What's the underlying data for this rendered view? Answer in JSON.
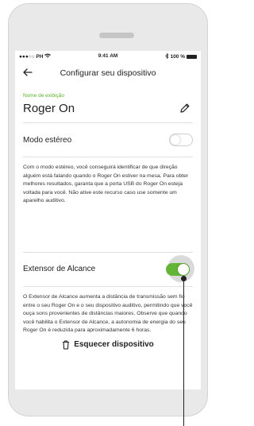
{
  "status_bar": {
    "carrier": "●●●○○ PH",
    "time": "9:41 AM",
    "battery_text": "100 %"
  },
  "nav": {
    "title": "Configurar seu dispositivo"
  },
  "device_name": {
    "label": "Nome de exibição",
    "value": "Roger On"
  },
  "stereo": {
    "label": "Modo estéreo",
    "enabled": false,
    "description": "Com o modo estéreo, você conseguirá identificar de que direção alguém está falando quando o Roger On estiver na mesa. Para obter melhores resultados, garanta que a porta USB do Roger On esteja voltada para você. Não ative este recurso caso use somente um aparelho auditivo."
  },
  "range_extender": {
    "label": "Extensor de Alcance",
    "enabled": true,
    "description": "O Extensor de Alcance aumenta a distância de transmissão sem fio entre o seu Roger On e o seu dispositivo auditivo, permitindo que você ouça sons provenientes de distâncias maiores. Observe que quando você habilita o Extensor de Alcance, a autonomia de energia do seu Roger On é reduzida para aproximadamente 6 horas."
  },
  "forget_device": {
    "label": "Esquecer dispositivo"
  },
  "colors": {
    "accent_green": "#64b437",
    "label_green": "#58b327"
  }
}
